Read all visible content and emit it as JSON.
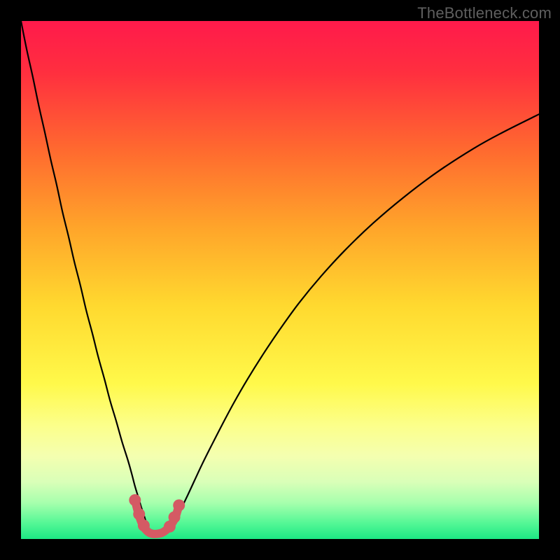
{
  "watermark": "TheBottleneck.com",
  "chart_data": {
    "type": "line",
    "title": "",
    "xlabel": "",
    "ylabel": "",
    "xlim": [
      0,
      100
    ],
    "ylim": [
      0,
      100
    ],
    "background_gradient": {
      "stops": [
        {
          "offset": 0.0,
          "color": "#ff1a4b"
        },
        {
          "offset": 0.1,
          "color": "#ff2f3f"
        },
        {
          "offset": 0.25,
          "color": "#ff6a2f"
        },
        {
          "offset": 0.4,
          "color": "#ffa52a"
        },
        {
          "offset": 0.55,
          "color": "#ffd92f"
        },
        {
          "offset": 0.7,
          "color": "#fff94a"
        },
        {
          "offset": 0.78,
          "color": "#fcff8a"
        },
        {
          "offset": 0.84,
          "color": "#f4ffb0"
        },
        {
          "offset": 0.89,
          "color": "#d9ffb8"
        },
        {
          "offset": 0.93,
          "color": "#a7ffad"
        },
        {
          "offset": 0.97,
          "color": "#53f795"
        },
        {
          "offset": 1.0,
          "color": "#1de884"
        }
      ]
    },
    "series": [
      {
        "name": "left-branch",
        "stroke": "#000000",
        "type": "line",
        "x": [
          0.0,
          1.1,
          2.3,
          3.4,
          4.6,
          5.7,
          6.9,
          8.0,
          9.2,
          10.3,
          11.5,
          12.6,
          13.8,
          14.9,
          16.1,
          17.2,
          18.4,
          19.5,
          20.7,
          21.4,
          22.0,
          22.7,
          23.2,
          23.8,
          24.5
        ],
        "y": [
          100,
          94.5,
          89.1,
          83.8,
          78.5,
          73.4,
          68.3,
          63.2,
          58.3,
          53.5,
          48.8,
          44.1,
          39.6,
          35.2,
          30.9,
          26.7,
          22.7,
          18.8,
          15.0,
          12.5,
          10.2,
          7.9,
          6.2,
          4.4,
          2.1
        ]
      },
      {
        "name": "right-branch",
        "stroke": "#000000",
        "type": "line",
        "x": [
          29.0,
          30.0,
          31.0,
          32.2,
          33.5,
          35.0,
          36.8,
          38.8,
          41.1,
          43.7,
          46.7,
          50.0,
          53.7,
          57.9,
          62.6,
          67.9,
          73.8,
          80.3,
          87.4,
          93.0,
          100.0
        ],
        "y": [
          2.1,
          4.0,
          6.0,
          8.5,
          11.3,
          14.5,
          18.1,
          22.0,
          26.3,
          30.8,
          35.6,
          40.5,
          45.6,
          50.7,
          55.8,
          60.9,
          65.9,
          70.8,
          75.4,
          78.5,
          82.0
        ]
      },
      {
        "name": "valley-floor",
        "stroke": "#d45a64",
        "type": "line",
        "x": [
          22.0,
          22.8,
          23.6,
          24.5,
          25.4,
          26.3,
          27.2,
          28.1,
          29.0,
          29.8,
          30.5
        ],
        "y": [
          7.5,
          4.5,
          2.5,
          1.4,
          1.0,
          1.0,
          1.2,
          1.8,
          2.8,
          4.2,
          6.5
        ]
      },
      {
        "name": "valley-markers",
        "stroke": "#d45a64",
        "type": "scatter",
        "x": [
          22.0,
          22.8,
          23.7,
          28.7,
          29.6,
          30.5
        ],
        "y": [
          7.5,
          4.8,
          2.6,
          2.4,
          4.2,
          6.5
        ]
      }
    ]
  }
}
